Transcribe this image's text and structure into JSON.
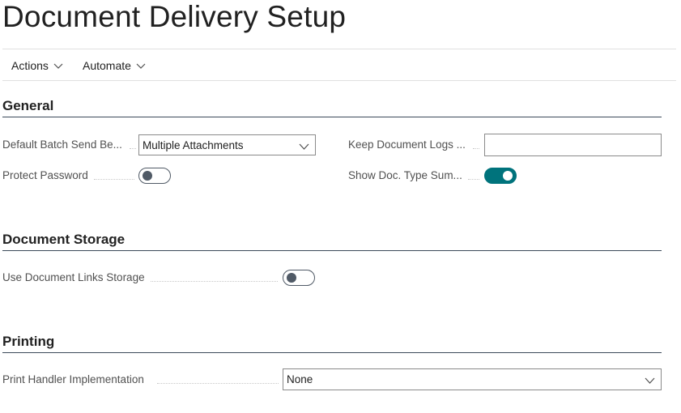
{
  "page": {
    "title": "Document Delivery Setup"
  },
  "actionbar": {
    "actions_label": "Actions",
    "automate_label": "Automate"
  },
  "general": {
    "title": "General",
    "default_batch": {
      "label": "Default Batch Send Be...",
      "value": "Multiple Attachments"
    },
    "keep_logs": {
      "label": "Keep Document Logs ...",
      "value": ""
    },
    "protect_password": {
      "label": "Protect Password",
      "checked": false
    },
    "show_doc_type": {
      "label": "Show Doc. Type Sum...",
      "checked": true
    }
  },
  "storage": {
    "title": "Document Storage",
    "use_links": {
      "label": "Use Document Links Storage",
      "checked": false
    }
  },
  "printing": {
    "title": "Printing",
    "handler": {
      "label": "Print Handler Implementation",
      "value": "None"
    }
  },
  "colors": {
    "accent": "#00737c",
    "section_line": "#3b4a5a"
  }
}
